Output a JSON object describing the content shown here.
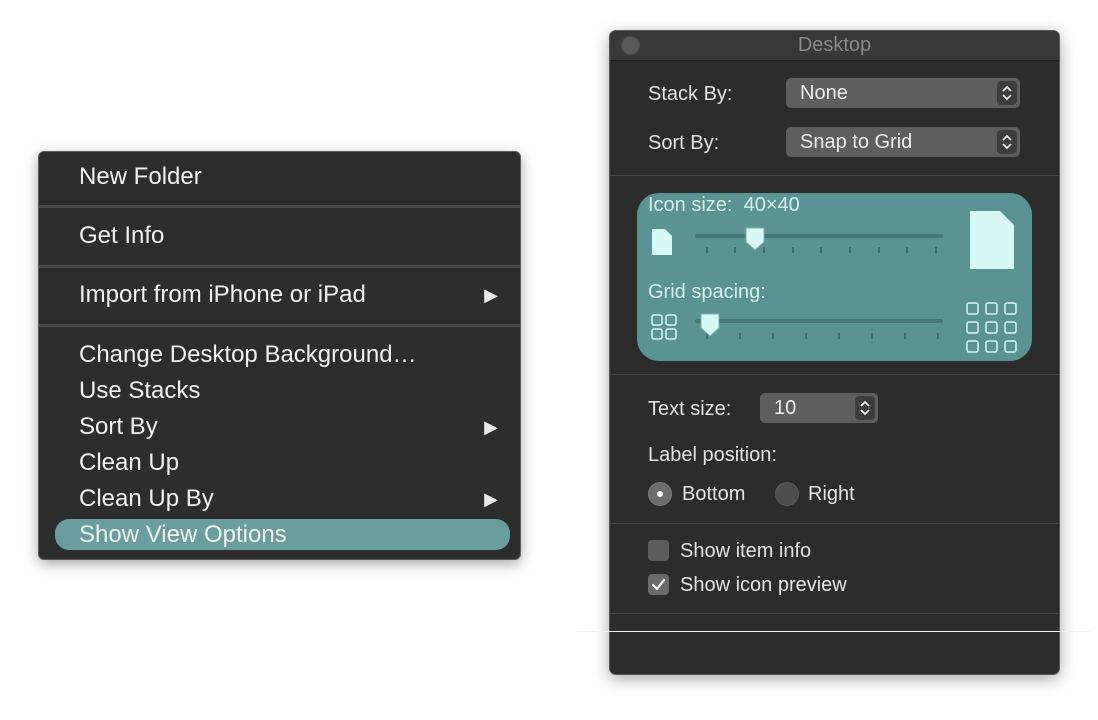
{
  "context_menu": {
    "items": [
      {
        "label": "New Folder"
      },
      {
        "label": "Get Info"
      },
      {
        "label": "Import from iPhone or iPad",
        "submenu_arrow": "▶"
      },
      {
        "label": "Change Desktop Background…"
      },
      {
        "label": "Use Stacks"
      },
      {
        "label": "Sort By",
        "submenu_arrow": "▶"
      },
      {
        "label": "Clean Up"
      },
      {
        "label": "Clean Up By",
        "submenu_arrow": "▶"
      },
      {
        "label": "Show View Options"
      }
    ],
    "selected_item": "Show View Options",
    "highlight_color": "#6a9d9d"
  },
  "panel": {
    "title": "Desktop",
    "stack_by": {
      "label": "Stack By:",
      "value": "None"
    },
    "sort_by": {
      "label": "Sort By:",
      "value": "Snap to Grid"
    },
    "icon_size": {
      "label": "Icon size:",
      "value": "40×40",
      "slider_level": 0.22
    },
    "grid_spacing": {
      "label": "Grid spacing:",
      "slider_level": 0.05
    },
    "text_size": {
      "label": "Text size:",
      "value": "10"
    },
    "label_position": {
      "label": "Label position:",
      "options": [
        {
          "label": "Bottom",
          "selected": true
        },
        {
          "label": "Right",
          "selected": false
        }
      ]
    },
    "show_item_info": {
      "label": "Show item info",
      "checked": false
    },
    "show_icon_preview": {
      "label": "Show icon preview",
      "checked": true
    },
    "accent_color": "#5a9393"
  }
}
